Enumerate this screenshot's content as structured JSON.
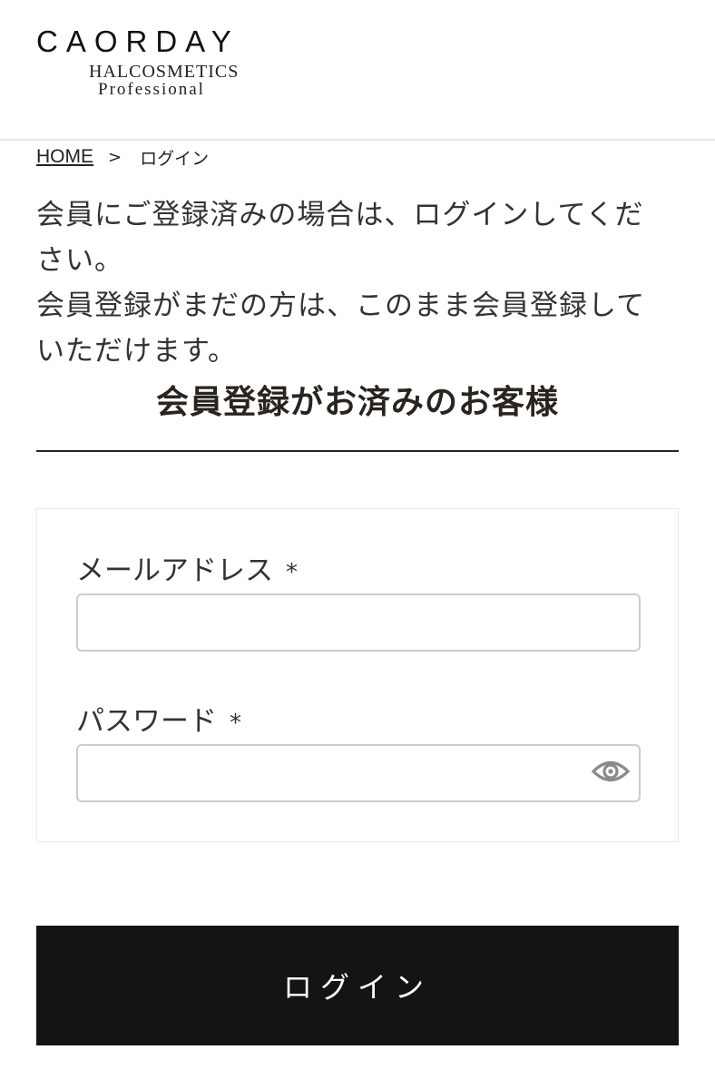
{
  "header": {
    "logo": {
      "main": "CAORDAY",
      "sub1": "HALCOSMETICS",
      "sub2": "Professional"
    }
  },
  "breadcrumb": {
    "home": "HOME",
    "separator": ">",
    "current": "ログイン"
  },
  "intro": {
    "line1": "会員にご登録済みの場合は、ログインしてください。",
    "line2": "会員登録がまだの方は、このまま会員登録していただけます。"
  },
  "section": {
    "title": "会員登録がお済みのお客様"
  },
  "form": {
    "email": {
      "label": "メールアドレス",
      "required_mark": "*",
      "value": ""
    },
    "password": {
      "label": "パスワード",
      "required_mark": "*",
      "value": "",
      "toggle_icon": "eye-icon"
    }
  },
  "login_button": {
    "label": "ログイン"
  },
  "colors": {
    "button_bg": "#141414",
    "button_text": "#ffffff",
    "title_text": "#2a2420",
    "input_border": "#cccccc"
  }
}
